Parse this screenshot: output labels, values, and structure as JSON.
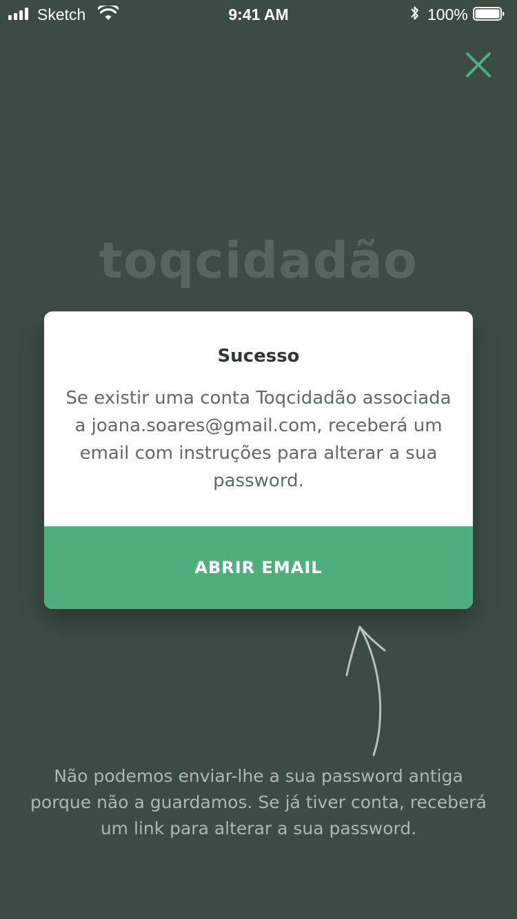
{
  "status_bar": {
    "carrier": "Sketch",
    "time": "9:41 AM",
    "battery_percent": "100%"
  },
  "logo": {
    "text": "toqcidadão"
  },
  "modal": {
    "title": "Sucesso",
    "message": "Se existir uma conta Toqcidadão associada a joana.soares@gmail.com, receberá um email com instruções para alterar a sua password.",
    "button_label": "ABRIR EMAIL"
  },
  "hint": {
    "text": "Não podemos enviar-lhe a sua password antiga porque não a guardamos. Se já tiver conta, receberá um link para alterar a sua password."
  },
  "colors": {
    "background": "#3b4d43",
    "accent": "#4fb07d",
    "close_icon": "#4fb07d",
    "modal_background": "#ffffff"
  },
  "icons": [
    "signal-icon",
    "wifi-icon",
    "bluetooth-icon",
    "battery-icon",
    "close-icon",
    "arrow-icon"
  ]
}
